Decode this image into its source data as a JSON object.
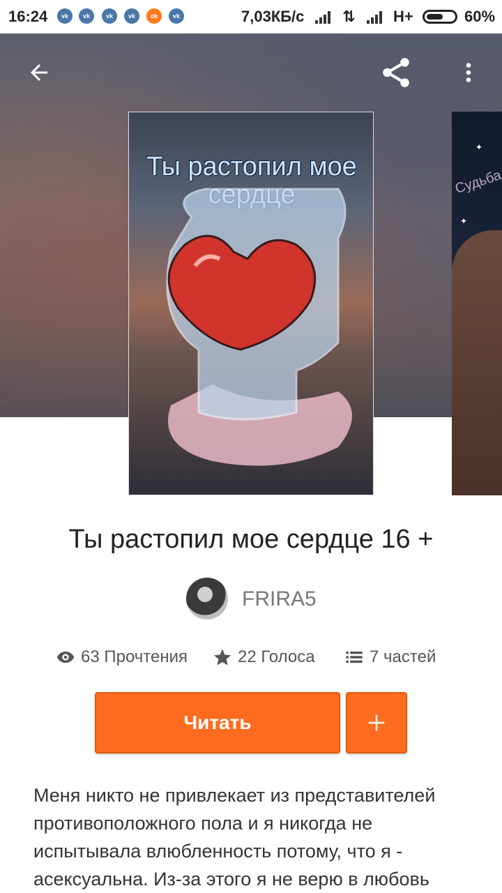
{
  "status_bar": {
    "time": "16:24",
    "notification_icons": [
      "vk-icon",
      "vk-icon",
      "vk-icon",
      "vk-icon",
      "ok-icon",
      "vk-icon"
    ],
    "network_speed": "7,03КБ/с",
    "network_type": "H+",
    "battery": "60%",
    "battery_level": 0.6
  },
  "toolbar": {
    "back_icon": "arrow-left-icon",
    "share_icon": "share-icon",
    "more_icon": "more-vertical-icon"
  },
  "cover": {
    "text": "Ты растопил мое сердце",
    "side_text": "Судьба"
  },
  "story": {
    "title": "Ты растопил мое сердце 16 +",
    "author": "FRIRA5",
    "stats": {
      "reads": "63 Прочтения",
      "votes": "22 Голоса",
      "parts": "7 частей"
    },
    "read_button": "Читать",
    "add_button": "+",
    "description": "Меня никто не привлекает из представителей противоположного пола и я никогда не испытывала влюбленность потому, что я - асексуальна. Из-за этого я не верю в любовь"
  },
  "colors": {
    "accent": "#ff6c1f",
    "text": "#222222",
    "muted": "#777777"
  }
}
